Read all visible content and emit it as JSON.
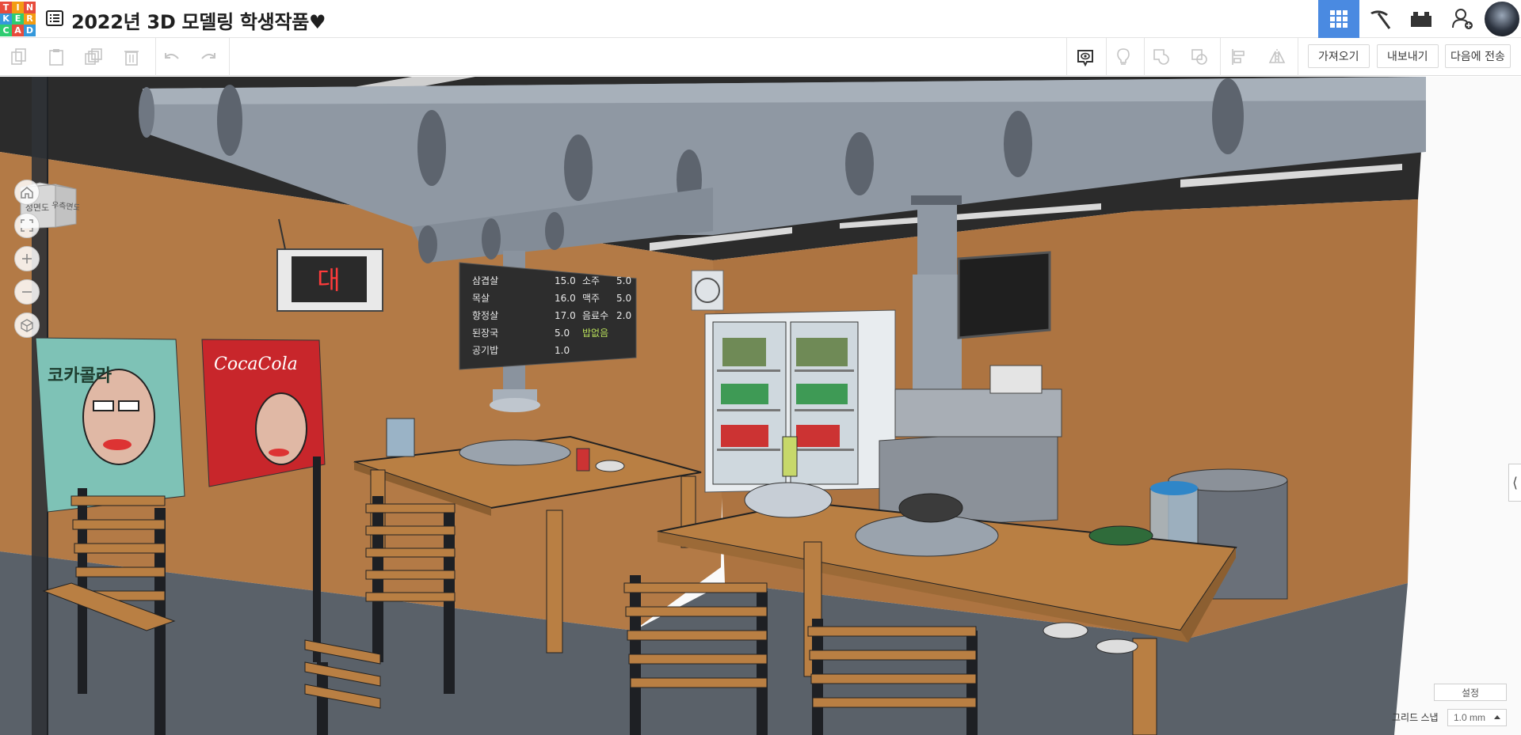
{
  "app": {
    "logo_letters": [
      "T",
      "I",
      "N",
      "K",
      "E",
      "R",
      "C",
      "A",
      "D"
    ],
    "logo_colors": [
      "#e74c3c",
      "#f39c12",
      "#e74c3c",
      "#3498db",
      "#2ecc71",
      "#f39c12",
      "#2ecc71",
      "#e74c3c",
      "#3498db"
    ],
    "title": "2022년 3D 모델링 학생작품♥"
  },
  "header": {
    "icons": [
      "grid-view-icon",
      "pickaxe-icon",
      "bricks-icon",
      "add-user-icon",
      "profile-avatar"
    ],
    "active_color": "#4a8ae1"
  },
  "toolbar": {
    "left_icons": [
      "copy-icon",
      "paste-icon",
      "duplicate-icon",
      "delete-icon",
      "undo-icon",
      "redo-icon"
    ],
    "right_icons": [
      "notes-icon",
      "light-bulb-icon",
      "shape-icon",
      "group-icon",
      "align-icon",
      "mirror-icon"
    ],
    "import_label": "가져오기",
    "export_label": "내보내기",
    "send_label": "다음에 전송"
  },
  "viewcube": {
    "front_label": "정면도",
    "right_label": "우측면도"
  },
  "nav": [
    "home-icon",
    "fit-view-icon",
    "zoom-in-icon",
    "zoom-out-icon",
    "perspective-icon"
  ],
  "scene": {
    "sign_text": "대",
    "menu_rows": [
      {
        "left": "삼겹살",
        "left_price": "15.0",
        "right": "소주",
        "right_price": "5.0"
      },
      {
        "left": "목살",
        "left_price": "16.0",
        "right": "맥주",
        "right_price": "5.0"
      },
      {
        "left": "항정살",
        "left_price": "17.0",
        "right": "음료수",
        "right_price": "2.0"
      },
      {
        "left": "된장국",
        "left_price": "5.0",
        "right": "밥없음",
        "right_price": ""
      },
      {
        "left": "공기밥",
        "left_price": "1.0",
        "right": "",
        "right_price": ""
      }
    ],
    "poster_left_text": "코카콜라",
    "poster_right_text": "CocaCola",
    "colors": {
      "wall": "#b37a46",
      "ceiling": "#2b2b2b",
      "floor": "#5a6169",
      "pipe": "#8f98a3",
      "table": "#b97f43",
      "chair_leg": "#1e2024"
    }
  },
  "settings": {
    "settings_label": "설정",
    "grid_snap_label": "그리드 스냅",
    "grid_snap_value": "1.0 mm"
  }
}
